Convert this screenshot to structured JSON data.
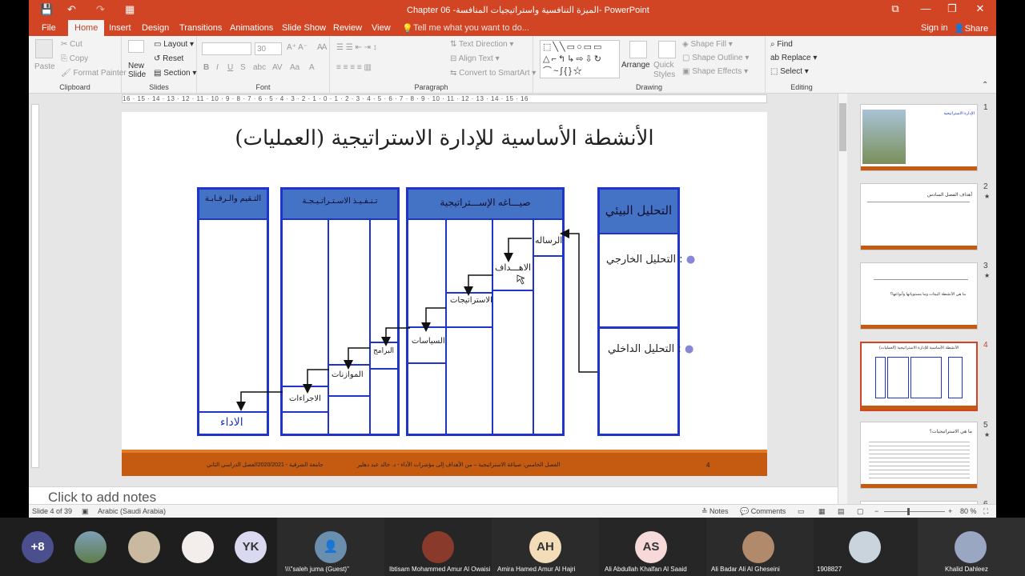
{
  "titlebar": {
    "title": "Chapter 06 -الميزة التنافسية واستراتيجيات المنافسة- PowerPoint",
    "restore_icon": "⧉",
    "minimize_icon": "—",
    "maximize_icon": "❐",
    "close_icon": "✕",
    "save_icon": "💾",
    "undo_icon": "↶",
    "redo_icon": "↷",
    "present_icon": "▦"
  },
  "tabs": [
    "File",
    "Home",
    "Insert",
    "Design",
    "Transitions",
    "Animations",
    "Slide Show",
    "Review",
    "View"
  ],
  "tell_me": "Tell me what you want to do...",
  "sign_in": "Sign in",
  "share": "Share",
  "ribbon": {
    "clipboard": {
      "paste": "Paste",
      "cut": "Cut",
      "copy": "Copy",
      "format_painter": "Format Painter",
      "label": "Clipboard"
    },
    "slides": {
      "new_slide": "New Slide",
      "layout": "Layout",
      "reset": "Reset",
      "section": "Section",
      "label": "Slides"
    },
    "font": {
      "font_size": "30",
      "label": "Font"
    },
    "paragraph": {
      "text_direction": "Text Direction",
      "align_text": "Align Text",
      "convert": "Convert to SmartArt",
      "label": "Paragraph"
    },
    "drawing": {
      "arrange": "Arrange",
      "quick_styles": "Quick Styles",
      "shape_fill": "Shape Fill",
      "shape_outline": "Shape Outline",
      "shape_effects": "Shape Effects",
      "label": "Drawing"
    },
    "editing": {
      "find": "Find",
      "replace": "Replace",
      "select": "Select",
      "label": "Editing"
    }
  },
  "ruler_text": "16 · 15 · 14 · 13 · 12 · 11 · 10 · 9 · 8 · 7 · 6 · 5 · 4 · 3 · 2 · 1 · 0 · 1 · 2 · 3 · 4 · 5 · 6 · 7 · 8 · 9 · 10 · 11 · 12 · 13 · 14 · 15 · 16",
  "slide": {
    "title": "الأنشطة الأساسية للإدارة الاستراتيجية (العمليات)",
    "col_analysis": {
      "header": "التحليل البيئي",
      "external": "التحليل الخارجي :",
      "internal": "التحليل الداخلي :"
    },
    "col_formulation": {
      "header": "صيـــاغه الإســـتراتيجية",
      "mission": "الرساله",
      "objectives": "الاهـــداف",
      "strategies": "الاستراتيجات",
      "policies": "السياسات"
    },
    "col_implementation": {
      "header": "تـنـفـيـذ الاسـتـراتـيـجـة",
      "programs": "البرامج",
      "budgets": "الموازنات",
      "procedures": "الاجراءات"
    },
    "col_evaluation": {
      "header": "التـقيم والـرقـابـة",
      "performance": "الاداء"
    },
    "footer_left": "جامعة الشرقية - 2020/2021الفصل الدراسي الثاني",
    "footer_mid": "الفصل الخامس: صياغة الاستراتيجية – من الأهداف إلى مؤشرات الأداء - د. خالد عبد دهلير",
    "footer_num": "4"
  },
  "thumbnails": [
    {
      "num": "1",
      "star": ""
    },
    {
      "num": "2",
      "star": "★"
    },
    {
      "num": "3",
      "star": "★"
    },
    {
      "num": "4",
      "star": ""
    },
    {
      "num": "5",
      "star": "★"
    },
    {
      "num": "6",
      "star": ""
    }
  ],
  "thumb_texts": {
    "t1": "الإدارة الاستراتيجية",
    "t2": "أهداف الفصل السادس",
    "t3": "ما هي الأنشطة البيئات وما مستوياتها وأنواعها؟",
    "t4": "الأنشطة الأساسية للإدارة الاستراتيجية (العمليات)",
    "t5": "ما هي الاستراتيجيات؟"
  },
  "notes_placeholder": "Click to add notes",
  "status": {
    "slide_of": "Slide 4 of 39",
    "language": "Arabic (Saudi Arabia)",
    "notes": "Notes",
    "comments": "Comments",
    "zoom": "80 %"
  },
  "meeting": {
    "more_count": "+8",
    "initials_yk": "YK",
    "p1": "\\\\\\\"saleh juma (Guest)\"",
    "p2": "Ibtisam Mohammed Amur Al Owaisi",
    "p3": "Amira Hamed Amur Al Hajri",
    "p3_initials": "AH",
    "p4": "Ali Abdullah Khalfan Al Saaid",
    "p4_initials": "AS",
    "p5": "Ali Badar Ali Al Gheseini",
    "p6": "1908827",
    "p7": "Khalid Dahleez"
  },
  "colors": {
    "accent": "#d14524",
    "diagram_blue": "#1f35c9",
    "header_blue": "#4472c4",
    "footer_orange": "#c55a11"
  }
}
